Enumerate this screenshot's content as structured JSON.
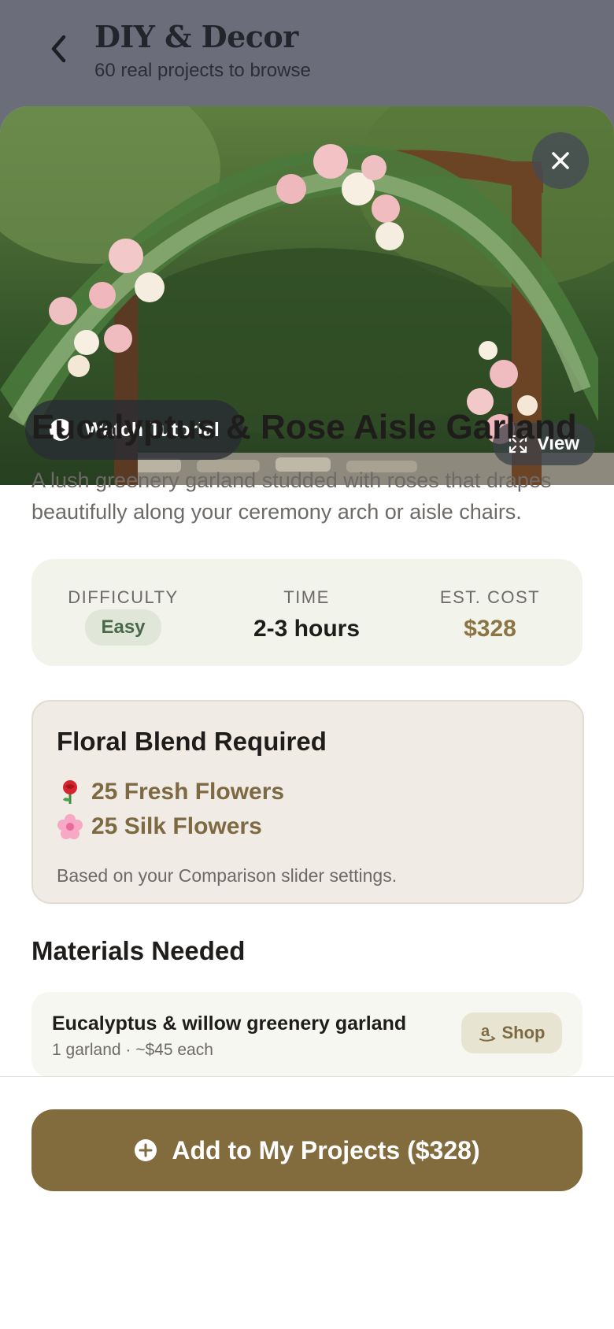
{
  "header": {
    "title": "DIY & Decor",
    "subtitle": "60 real projects to browse",
    "back_icon": "chevron-left-icon"
  },
  "hero": {
    "watch_label": "Watch Tutorial",
    "view_label": "View"
  },
  "project": {
    "title": "Eucalyptus & Rose Aisle Garland",
    "description": "A lush greenery garland studded with roses that drapes beautifully along your ceremony arch or aisle chairs."
  },
  "stats": {
    "difficulty_label": "DIFFICULTY",
    "difficulty_value": "Easy",
    "time_label": "TIME",
    "time_value": "2-3 hours",
    "cost_label": "EST. COST",
    "cost_value": "$328"
  },
  "floral": {
    "title": "Floral Blend Required",
    "fresh": "25 Fresh Flowers",
    "silk": "25 Silk Flowers",
    "note": "Based on your Comparison slider settings."
  },
  "materials": {
    "title": "Materials Needed",
    "items": [
      {
        "name": "Eucalyptus & willow greenery garland",
        "meta": "1 garland · ~$45 each",
        "shop_label": "Shop"
      }
    ]
  },
  "cta": {
    "label": "Add to My Projects ($328)"
  },
  "colors": {
    "accent": "#826b3c",
    "easy_badge_bg": "#e0e6d8",
    "easy_badge_text": "#47694a"
  }
}
